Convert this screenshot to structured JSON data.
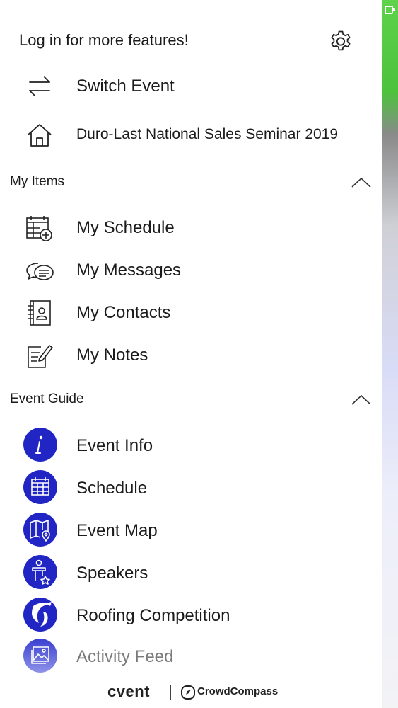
{
  "header": {
    "login_text": "Log in for more features!",
    "settings_icon": "gear-icon"
  },
  "top_items": [
    {
      "label": "Switch Event",
      "icon": "switch-arrows-icon"
    },
    {
      "label": "Duro-Last National Sales  Seminar 2019",
      "icon": "home-icon"
    }
  ],
  "my_items": {
    "title": "My Items",
    "items": [
      {
        "label": "My Schedule",
        "icon": "calendar-add-icon"
      },
      {
        "label": "My Messages",
        "icon": "chat-bubbles-icon"
      },
      {
        "label": "My Contacts",
        "icon": "address-book-icon"
      },
      {
        "label": "My Notes",
        "icon": "note-pencil-icon"
      }
    ]
  },
  "event_guide": {
    "title": "Event Guide",
    "accent_color": "#2025c4",
    "items": [
      {
        "label": "Event Info",
        "icon": "info-icon"
      },
      {
        "label": "Schedule",
        "icon": "calendar-icon"
      },
      {
        "label": "Event Map",
        "icon": "map-icon"
      },
      {
        "label": "Speakers",
        "icon": "speaker-podium-icon"
      },
      {
        "label": "Roofing Competition",
        "icon": "competition-logo-icon"
      },
      {
        "label": "Activity Feed",
        "icon": "photo-feed-icon"
      }
    ]
  },
  "footer": {
    "brand": "cvent",
    "partner": "CrowdCompass"
  }
}
